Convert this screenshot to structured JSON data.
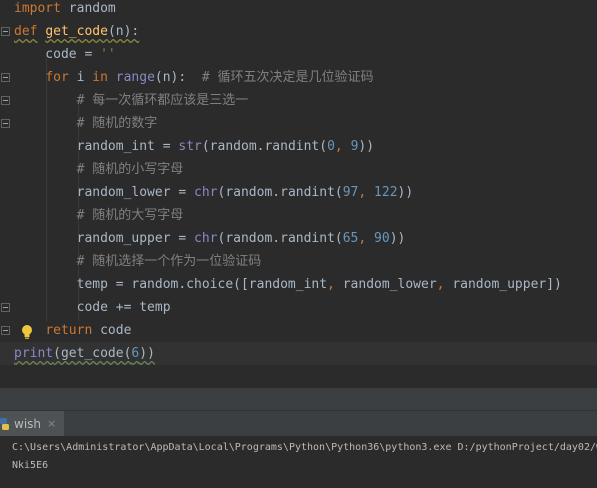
{
  "editor": {
    "lines": [
      {
        "segments": [
          {
            "t": "import",
            "c": "kw"
          },
          {
            "t": " random",
            "c": ""
          }
        ]
      },
      {
        "segments": [
          {
            "t": "def",
            "c": "kw squiggle-y"
          },
          {
            "t": " ",
            "c": ""
          },
          {
            "t": "get_code",
            "c": "fn-name squiggle-y"
          },
          {
            "t": "(n):",
            "c": "squiggle-y"
          }
        ]
      },
      {
        "segments": [
          {
            "t": "    code = ",
            "c": ""
          },
          {
            "t": "''",
            "c": "str"
          }
        ]
      },
      {
        "segments": [
          {
            "t": "    ",
            "c": ""
          },
          {
            "t": "for",
            "c": "kw"
          },
          {
            "t": " i ",
            "c": ""
          },
          {
            "t": "in",
            "c": "kw"
          },
          {
            "t": " ",
            "c": ""
          },
          {
            "t": "range",
            "c": "builtin"
          },
          {
            "t": "(n):  ",
            "c": ""
          },
          {
            "t": "# 循环五次决定是几位验证码",
            "c": "comment"
          }
        ]
      },
      {
        "segments": [
          {
            "t": "        ",
            "c": ""
          },
          {
            "t": "# 每一次循环都应该是三选一",
            "c": "comment"
          }
        ]
      },
      {
        "segments": [
          {
            "t": "        ",
            "c": ""
          },
          {
            "t": "# 随机的数字",
            "c": "comment"
          }
        ]
      },
      {
        "segments": [
          {
            "t": "        random_int = ",
            "c": ""
          },
          {
            "t": "str",
            "c": "builtin"
          },
          {
            "t": "(random.randint(",
            "c": ""
          },
          {
            "t": "0",
            "c": "num"
          },
          {
            "t": ", ",
            "c": "kw"
          },
          {
            "t": "9",
            "c": "num"
          },
          {
            "t": "))",
            "c": ""
          }
        ]
      },
      {
        "segments": [
          {
            "t": "        ",
            "c": ""
          },
          {
            "t": "# 随机的小写字母",
            "c": "comment"
          }
        ]
      },
      {
        "segments": [
          {
            "t": "        random_lower = ",
            "c": ""
          },
          {
            "t": "chr",
            "c": "builtin"
          },
          {
            "t": "(random.randint(",
            "c": ""
          },
          {
            "t": "97",
            "c": "num"
          },
          {
            "t": ", ",
            "c": "kw"
          },
          {
            "t": "122",
            "c": "num"
          },
          {
            "t": "))",
            "c": ""
          }
        ]
      },
      {
        "segments": [
          {
            "t": "        ",
            "c": ""
          },
          {
            "t": "# 随机的大写字母",
            "c": "comment"
          }
        ]
      },
      {
        "segments": [
          {
            "t": "        random_upper = ",
            "c": ""
          },
          {
            "t": "chr",
            "c": "builtin"
          },
          {
            "t": "(random.randint(",
            "c": ""
          },
          {
            "t": "65",
            "c": "num"
          },
          {
            "t": ", ",
            "c": "kw"
          },
          {
            "t": "90",
            "c": "num"
          },
          {
            "t": "))",
            "c": ""
          }
        ]
      },
      {
        "segments": [
          {
            "t": "        ",
            "c": ""
          },
          {
            "t": "# 随机选择一个作为一位验证码",
            "c": "comment"
          }
        ]
      },
      {
        "segments": [
          {
            "t": "        temp = random.choice([random_int",
            "c": ""
          },
          {
            "t": ", ",
            "c": "kw"
          },
          {
            "t": "random_lower",
            "c": ""
          },
          {
            "t": ", ",
            "c": "kw"
          },
          {
            "t": "random_upper])",
            "c": ""
          }
        ]
      },
      {
        "segments": [
          {
            "t": "        code += temp",
            "c": ""
          }
        ]
      },
      {
        "segments": [
          {
            "t": "    ",
            "c": ""
          },
          {
            "t": "return",
            "c": "kw"
          },
          {
            "t": " code",
            "c": ""
          }
        ]
      },
      {
        "segments": [
          {
            "t": "print",
            "c": "builtin squiggle"
          },
          {
            "t": "(get_code(",
            "c": "squiggle"
          },
          {
            "t": "6",
            "c": "num squiggle"
          },
          {
            "t": "))",
            "c": "squiggle"
          }
        ]
      }
    ]
  },
  "run_panel": {
    "tab_label": "wish",
    "close_glyph": "×"
  },
  "console": {
    "command": "C:\\Users\\Administrator\\AppData\\Local\\Programs\\Python\\Python36\\python3.exe D:/pythonProject/day02/w",
    "output": "Nki5E6"
  },
  "colors": {
    "keyword": "#cc7832",
    "function": "#ffc66d",
    "builtin": "#8888c6",
    "number": "#6897bb",
    "string": "#6a8759",
    "comment": "#808080"
  }
}
